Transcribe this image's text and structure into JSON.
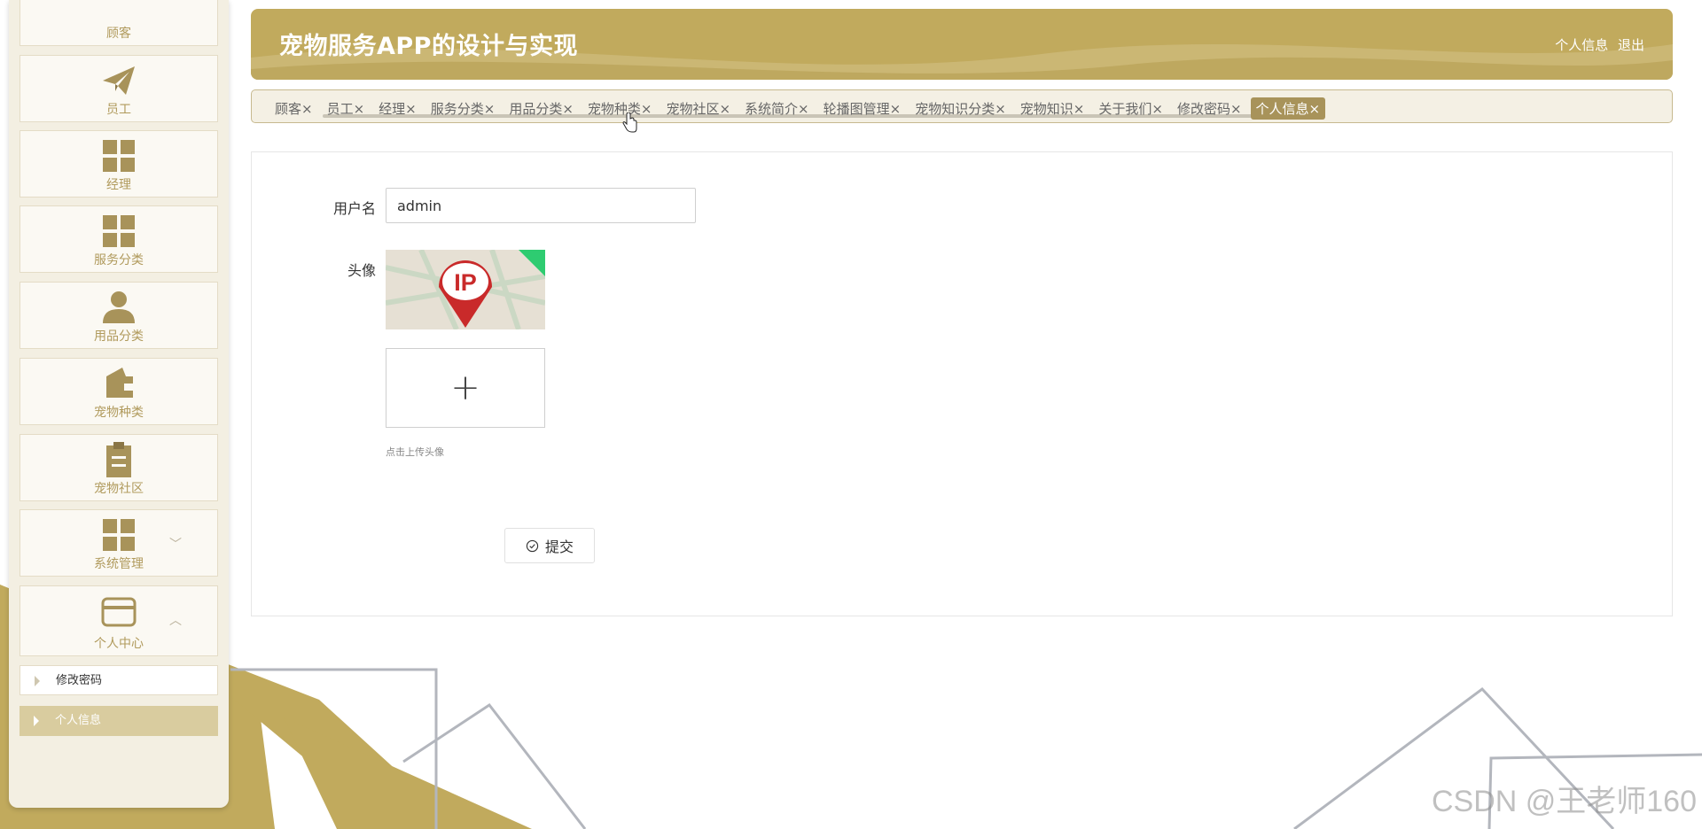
{
  "app": {
    "title": "宠物服务APP的设计与实现",
    "header_links": [
      "个人信息",
      "退出"
    ]
  },
  "colors": {
    "brand": "#c1aa5d",
    "brand_dark": "#a8935a",
    "sidebar_bg": "#f3efe2",
    "menu_label": "#b09a5c"
  },
  "sidebar": {
    "items": [
      {
        "label": "顾客",
        "icon": "user-icon"
      },
      {
        "label": "员工",
        "icon": "paper-plane-icon"
      },
      {
        "label": "经理",
        "icon": "grid-icon"
      },
      {
        "label": "服务分类",
        "icon": "grid-icon"
      },
      {
        "label": "用品分类",
        "icon": "person-icon"
      },
      {
        "label": "宠物种类",
        "icon": "wallet-icon"
      },
      {
        "label": "宠物社区",
        "icon": "clipboard-icon"
      },
      {
        "label": "系统管理",
        "icon": "grid-icon",
        "chevron": "﹀"
      },
      {
        "label": "个人中心",
        "icon": "card-icon",
        "chevron": "︿"
      }
    ],
    "sub_items": [
      {
        "label": "修改密码",
        "active": false
      },
      {
        "label": "个人信息",
        "active": true
      }
    ]
  },
  "tabs": [
    {
      "label": "顾客×",
      "active": false
    },
    {
      "label": "员工×",
      "active": false
    },
    {
      "label": "经理×",
      "active": false
    },
    {
      "label": "服务分类×",
      "active": false
    },
    {
      "label": "用品分类×",
      "active": false
    },
    {
      "label": "宠物种类×",
      "active": false
    },
    {
      "label": "宠物社区×",
      "active": false
    },
    {
      "label": "系统简介×",
      "active": false
    },
    {
      "label": "轮播图管理×",
      "active": false
    },
    {
      "label": "宠物知识分类×",
      "active": false
    },
    {
      "label": "宠物知识×",
      "active": false
    },
    {
      "label": "关于我们×",
      "active": false
    },
    {
      "label": "修改密码×",
      "active": false
    },
    {
      "label": "个人信息×",
      "active": true
    }
  ],
  "form": {
    "username_label": "用户名",
    "username_value": "admin",
    "avatar_label": "头像",
    "avatar_text": "IP",
    "upload_plus": "+",
    "upload_hint": "点击上传头像",
    "submit_label": "提交"
  },
  "watermark": "CSDN @王老师160"
}
